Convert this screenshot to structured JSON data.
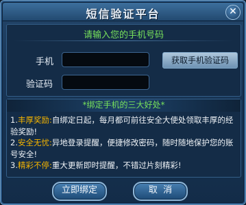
{
  "window": {
    "title": "短信验证平台",
    "close_symbol": "✕"
  },
  "form": {
    "prompt": "请输入您的手机号码",
    "phone_label": "手机",
    "phone_value": "",
    "code_label": "验证码",
    "code_value": "",
    "get_code_label": "获取手机验证码"
  },
  "benefits": {
    "header": "*绑定手机的三大好处*",
    "items": [
      {
        "prefix": "1.",
        "title": "丰厚奖励:",
        "text": "自绑定日起，每月都可前往安全大使处领取丰厚的经验奖励!"
      },
      {
        "prefix": "2.",
        "title": "安全无忧:",
        "text": "异地登录提醒，便捷修改密码，随时随地保护您的账号安全!"
      },
      {
        "prefix": "3.",
        "title": "精彩不停:",
        "text": "重大更新即时提醒，不错过片刻精彩!"
      }
    ]
  },
  "buttons": {
    "bind_label": "立即绑定",
    "cancel_label": "取  消"
  },
  "colors": {
    "accent_green": "#77e05b",
    "highlight_gold": "#f4b400"
  }
}
